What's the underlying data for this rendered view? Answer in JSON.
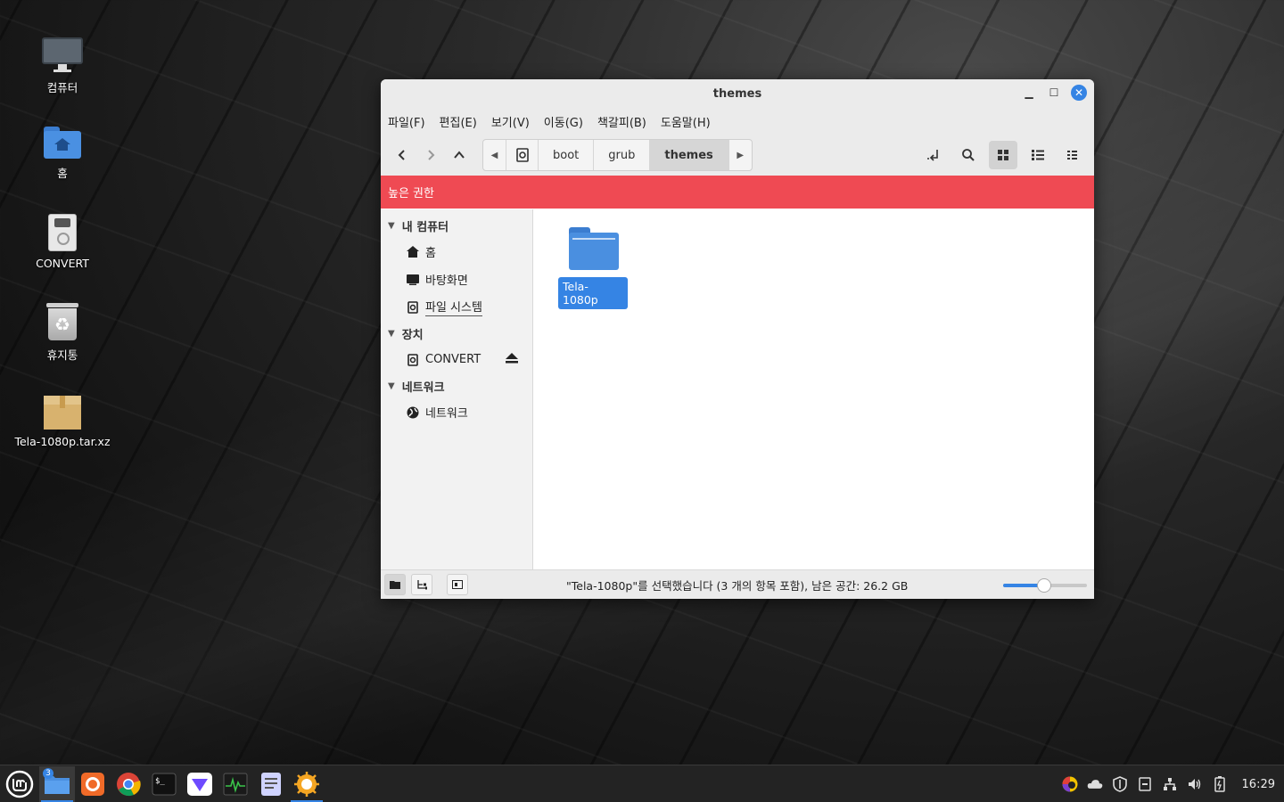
{
  "desktop": {
    "icons": [
      {
        "label": "컴퓨터",
        "icon": "computer-icon"
      },
      {
        "label": "홈",
        "icon": "home-folder-icon"
      },
      {
        "label": "CONVERT",
        "icon": "drive-icon"
      },
      {
        "label": "휴지통",
        "icon": "trash-icon"
      },
      {
        "label": "Tela-1080p.tar.xz",
        "icon": "archive-icon"
      }
    ]
  },
  "window": {
    "title": "themes",
    "menu": [
      "파일(F)",
      "편집(E)",
      "보기(V)",
      "이동(G)",
      "책갈피(B)",
      "도움말(H)"
    ],
    "path": [
      "boot",
      "grub",
      "themes"
    ],
    "root_banner": "높은 권한",
    "sidebar": {
      "sections": [
        {
          "title": "내 컴퓨터",
          "items": [
            "홈",
            "바탕화면",
            "파일 시스템"
          ]
        },
        {
          "title": "장치",
          "items": [
            "CONVERT"
          ]
        },
        {
          "title": "네트워크",
          "items": [
            "네트워크"
          ]
        }
      ]
    },
    "files": [
      {
        "name": "Tela-1080p",
        "type": "folder",
        "selected": true
      }
    ],
    "status": "\"Tela-1080p\"를 선택했습니다 (3 개의 항목 포함), 남은 공간: 26.2 GB",
    "zoom_level_fraction": 0.5
  },
  "taskbar": {
    "apps": [
      "menu",
      "files",
      "firefox",
      "chrome",
      "terminal",
      "proton-vpn",
      "system-monitor",
      "text-editor",
      "xnview"
    ],
    "files_badge": "3",
    "clock": "16:29"
  },
  "colors": {
    "accent": "#3584e4",
    "root_banner": "#ef4a53"
  }
}
